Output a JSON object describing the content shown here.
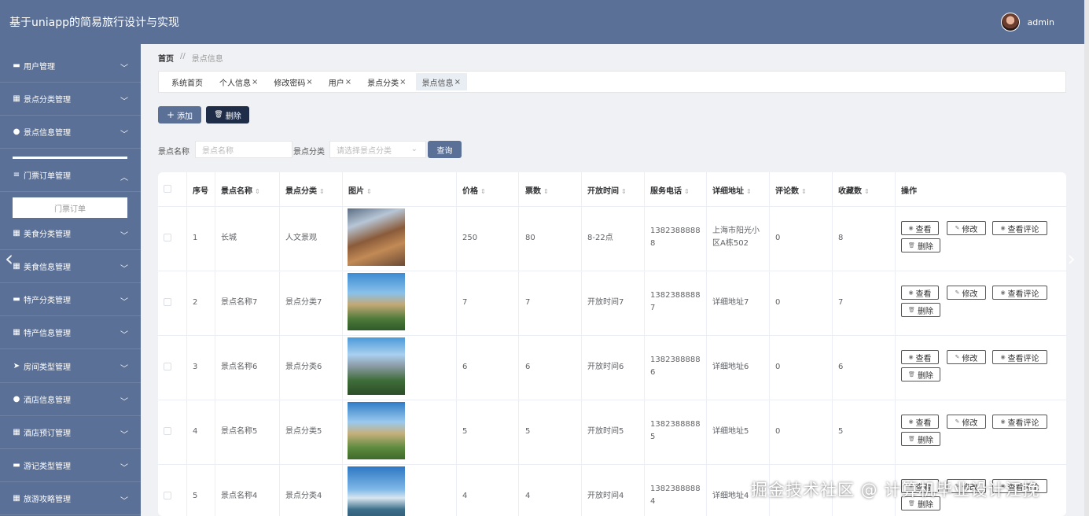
{
  "app": {
    "title": "基于uniapp的简易旅行设计与实现",
    "user": "admin"
  },
  "sidebar": {
    "items": [
      {
        "label": "用户管理",
        "icon": "users-icon",
        "glyph": "▬"
      },
      {
        "label": "景点分类管理",
        "icon": "grid-icon",
        "glyph": "▦"
      },
      {
        "label": "景点信息管理",
        "icon": "location-pin-icon",
        "glyph": "●"
      },
      {
        "label": "门票订单管理",
        "icon": "sliders-icon",
        "glyph": "≡",
        "expanded": true
      },
      {
        "label": "美食分类管理",
        "icon": "grid-icon",
        "glyph": "▦"
      },
      {
        "label": "美食信息管理",
        "icon": "grid-icon",
        "glyph": "▦"
      },
      {
        "label": "特产分类管理",
        "icon": "monitor-icon",
        "glyph": "▬"
      },
      {
        "label": "特产信息管理",
        "icon": "grid-icon",
        "glyph": "▦"
      },
      {
        "label": "房间类型管理",
        "icon": "paper-plane-icon",
        "glyph": "➤"
      },
      {
        "label": "酒店信息管理",
        "icon": "person-icon",
        "glyph": "●"
      },
      {
        "label": "酒店预订管理",
        "icon": "grid-icon",
        "glyph": "▦"
      },
      {
        "label": "游记类型管理",
        "icon": "tag-icon",
        "glyph": "▬"
      },
      {
        "label": "旅游攻略管理",
        "icon": "grid-icon",
        "glyph": "▦"
      }
    ],
    "sub_item": "门票订单"
  },
  "breadcrumb": {
    "home": "首页",
    "sep": "//",
    "current": "景点信息"
  },
  "tabs": [
    {
      "label": "系统首页",
      "closable": ""
    },
    {
      "label": "个人信息",
      "closable": "×"
    },
    {
      "label": "修改密码",
      "closable": "×"
    },
    {
      "label": "用户",
      "closable": "×"
    },
    {
      "label": "景点分类",
      "closable": "×"
    },
    {
      "label": "景点信息",
      "closable": "×"
    }
  ],
  "toolbar": {
    "add": "添加",
    "delete": "删除",
    "add_glyph": "+",
    "delete_glyph": "🗑"
  },
  "filters": {
    "name_label": "景点名称",
    "name_placeholder": "景点名称",
    "category_label": "景点分类",
    "category_placeholder": "请选择景点分类",
    "query": "查询"
  },
  "table": {
    "headers": [
      "序号",
      "景点名称",
      "景点分类",
      "图片",
      "价格",
      "票数",
      "开放时间",
      "服务电话",
      "详细地址",
      "评论数",
      "收藏数",
      "操作"
    ],
    "sortable": [
      "",
      "⇕",
      "⇕",
      "⇕",
      "⇕",
      "⇕",
      "⇕",
      "⇕",
      "⇕",
      "⇕",
      "⇕",
      ""
    ],
    "rows": [
      {
        "no": "1",
        "name": "长城",
        "category": "人文景观",
        "price": "250",
        "tickets": "80",
        "open": "8-22点",
        "phone": "13823888888",
        "address": "上海市阳光小区A栋502",
        "comments": "0",
        "favorites": "8"
      },
      {
        "no": "2",
        "name": "景点名称7",
        "category": "景点分类7",
        "price": "7",
        "tickets": "7",
        "open": "开放时间7",
        "phone": "13823888887",
        "address": "详细地址7",
        "comments": "0",
        "favorites": "7"
      },
      {
        "no": "3",
        "name": "景点名称6",
        "category": "景点分类6",
        "price": "6",
        "tickets": "6",
        "open": "开放时间6",
        "phone": "13823888886",
        "address": "详细地址6",
        "comments": "0",
        "favorites": "6"
      },
      {
        "no": "4",
        "name": "景点名称5",
        "category": "景点分类5",
        "price": "5",
        "tickets": "5",
        "open": "开放时间5",
        "phone": "13823888885",
        "address": "详细地址5",
        "comments": "0",
        "favorites": "5"
      },
      {
        "no": "5",
        "name": "景点名称4",
        "category": "景点分类4",
        "price": "4",
        "tickets": "4",
        "open": "开放时间4",
        "phone": "13823888884",
        "address": "详细地址4",
        "comments": "",
        "favorites": ""
      }
    ],
    "actions": {
      "view": "查看",
      "edit": "修改",
      "view_comments": "查看评论",
      "delete": "删除"
    }
  },
  "watermark": "掘金技术社区 @ 计算机毕业设计江挽"
}
